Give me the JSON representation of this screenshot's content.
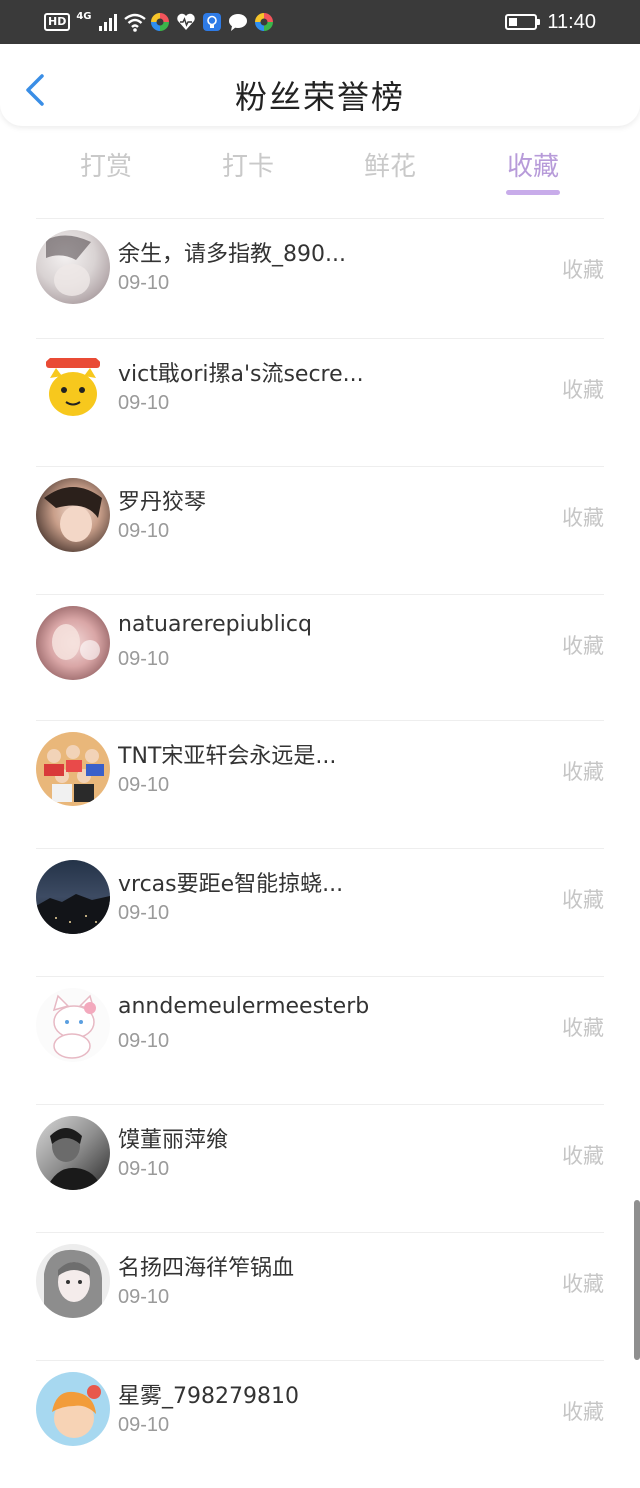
{
  "status_bar": {
    "network_badge": "HD",
    "network_type": "4G",
    "time": "11:40",
    "battery_level": 0.35,
    "icons": [
      "signal-icon",
      "wifi-icon",
      "app-color-icon",
      "heart-icon",
      "bulb-icon",
      "chat-icon",
      "app-color-icon"
    ]
  },
  "header": {
    "title": "粉丝荣誉榜",
    "back_icon": "chevron-left-icon"
  },
  "tabs": [
    {
      "label": "打赏",
      "active": false
    },
    {
      "label": "打卡",
      "active": false
    },
    {
      "label": "鲜花",
      "active": false
    },
    {
      "label": "收藏",
      "active": true
    }
  ],
  "colors": {
    "accent": "#b79bd9",
    "underline": "#c8acea",
    "back_icon": "#3a8ee6",
    "status_bar": "#3a3a3a"
  },
  "list": [
    {
      "name": "余生，请多指教_890...",
      "date": "09-10",
      "type": "收藏",
      "avatar": "avatar-photo"
    },
    {
      "name": "vict戢ori摞a's流secre...",
      "date": "09-10",
      "type": "收藏",
      "avatar": "avatar-cartoon-cat"
    },
    {
      "name": "罗丹狡琴",
      "date": "09-10",
      "type": "收藏",
      "avatar": "avatar-photo"
    },
    {
      "name": "natuarerepiublicq",
      "date": "09-10",
      "type": "收藏",
      "avatar": "avatar-photo"
    },
    {
      "name": "TNT宋亚轩会永远是...",
      "date": "09-10",
      "type": "收藏",
      "avatar": "avatar-group-photo"
    },
    {
      "name": "vrcas要距e智能掠蛲...",
      "date": "09-10",
      "type": "收藏",
      "avatar": "avatar-night-sky"
    },
    {
      "name": "anndemeulermeesterb",
      "date": "09-10",
      "type": "收藏",
      "avatar": "avatar-cartoon-cat"
    },
    {
      "name": "馍董丽萍飨",
      "date": "09-10",
      "type": "收藏",
      "avatar": "avatar-photo"
    },
    {
      "name": "名扬四海徉笮锅血",
      "date": "09-10",
      "type": "收藏",
      "avatar": "avatar-drawing"
    },
    {
      "name": "星雾_798279810",
      "date": "09-10",
      "type": "收藏",
      "avatar": "avatar-cartoon"
    }
  ]
}
